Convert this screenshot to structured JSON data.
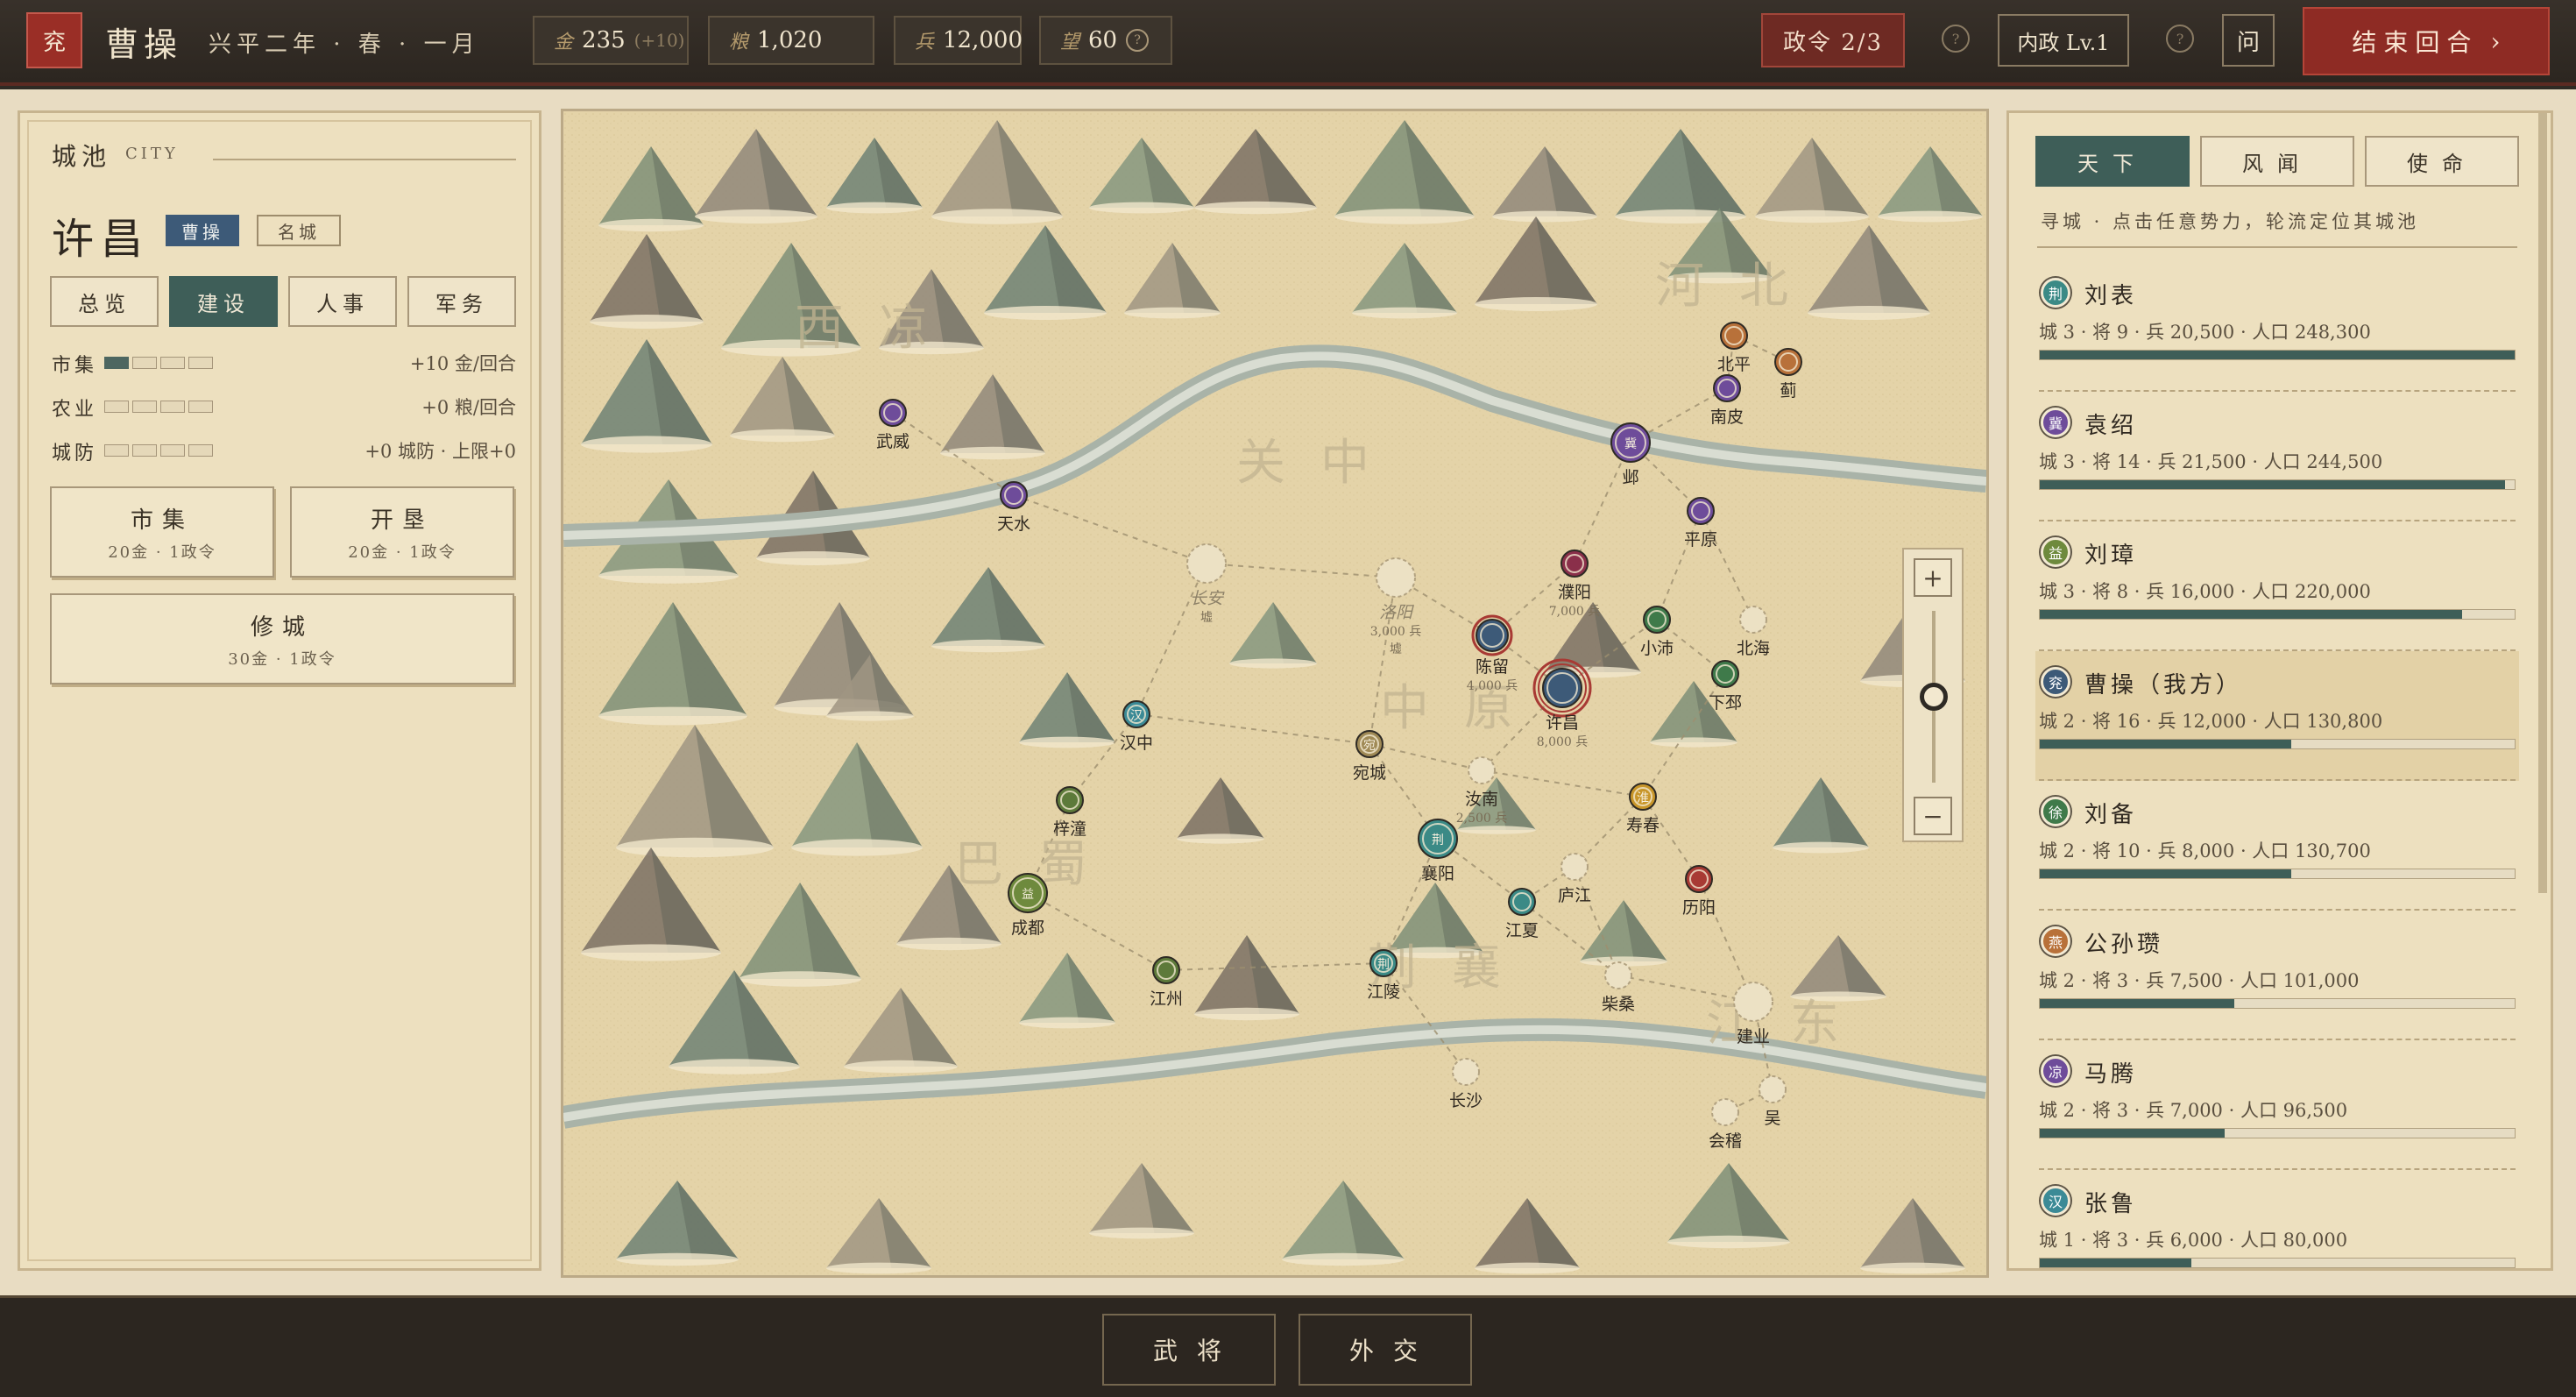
{
  "topbar": {
    "seal": "兖",
    "player": "曹操",
    "date": "兴平二年 · 春 · 一月",
    "resources": [
      {
        "label": "金",
        "value": "235",
        "sub": "(+10)"
      },
      {
        "label": "粮",
        "value": "1,020",
        "sub": ""
      },
      {
        "label": "兵",
        "value": "12,000",
        "sub": ""
      },
      {
        "label": "望",
        "value": "60",
        "sub": ""
      }
    ],
    "actions": "政令 2/3",
    "admin": "内政 Lv.1",
    "ask": "问",
    "end_turn": "结束回合",
    "end_turn_arrow": "›",
    "help_glyph": "?"
  },
  "left": {
    "title": "城池",
    "title_en": "CITY",
    "city_name": "许昌",
    "owner_tag": "曹操",
    "city_tag": "名城",
    "tabs": [
      "总览",
      "建设",
      "人事",
      "军务"
    ],
    "active_tab": 1,
    "stats": [
      {
        "name": "市集",
        "level": 1,
        "max": 4,
        "value": "+10 金/回合"
      },
      {
        "name": "农业",
        "level": 0,
        "max": 4,
        "value": "+0 粮/回合"
      },
      {
        "name": "城防",
        "level": 0,
        "max": 4,
        "value": "+0 城防 · 上限+0"
      }
    ],
    "buttons": [
      {
        "title": "市集",
        "cost": "20金 · 1政令"
      },
      {
        "title": "开垦",
        "cost": "20金 · 1政令"
      },
      {
        "title": "修城",
        "cost": "30金 · 1政令"
      }
    ]
  },
  "map": {
    "regions": [
      {
        "name": "西凉"
      },
      {
        "name": "河北"
      },
      {
        "name": "关中"
      },
      {
        "name": "中原"
      },
      {
        "name": "巴蜀"
      },
      {
        "name": "荆襄"
      },
      {
        "name": "江东"
      }
    ],
    "cities": [
      {
        "id": "wuwei",
        "name": "武威",
        "color": "#6e4c9a",
        "glyph": ""
      },
      {
        "id": "tianshui",
        "name": "天水",
        "color": "#6e4c9a",
        "glyph": ""
      },
      {
        "id": "changan",
        "name": "长安",
        "color": "",
        "glyph": "",
        "note": "墟"
      },
      {
        "id": "luoyang",
        "name": "洛阳",
        "color": "",
        "glyph": "",
        "note": "3,000 兵",
        "note2": "墟"
      },
      {
        "id": "hanzhong",
        "name": "汉中",
        "color": "#3b8a96",
        "glyph": "汉"
      },
      {
        "id": "zitong",
        "name": "梓潼",
        "color": "#5d7a3a",
        "glyph": ""
      },
      {
        "id": "chengdu",
        "name": "成都",
        "color": "#6e8a3d",
        "glyph": "益"
      },
      {
        "id": "jiangzhou",
        "name": "江州",
        "color": "#5d7a3a",
        "glyph": ""
      },
      {
        "id": "wancheng",
        "name": "宛城",
        "color": "#a08a56",
        "glyph": "宛"
      },
      {
        "id": "xiangyang",
        "name": "襄阳",
        "color": "#3b8a86",
        "glyph": "荆"
      },
      {
        "id": "jiangling",
        "name": "江陵",
        "color": "#3b8a86",
        "glyph": "荆"
      },
      {
        "id": "jiangxia",
        "name": "江夏",
        "color": "#3b8a86",
        "glyph": ""
      },
      {
        "id": "runan",
        "name": "汝南",
        "color": "",
        "glyph": "",
        "note": "2,500 兵"
      },
      {
        "id": "chenliu",
        "name": "陈留",
        "color": "#3d5a78",
        "glyph": "",
        "note": "4,000 兵"
      },
      {
        "id": "xuchang",
        "name": "许昌",
        "color": "#3d5a78",
        "glyph": "",
        "note": "8,000 兵"
      },
      {
        "id": "puyang",
        "name": "濮阳",
        "color": "#8a2f4a",
        "glyph": "",
        "note": "7,000 兵"
      },
      {
        "id": "xiaopei",
        "name": "小沛",
        "color": "#3f7a4a",
        "glyph": ""
      },
      {
        "id": "xiapi",
        "name": "下邳",
        "color": "#3f7a4a",
        "glyph": ""
      },
      {
        "id": "beihai",
        "name": "北海",
        "color": "",
        "glyph": ""
      },
      {
        "id": "pingyuan",
        "name": "平原",
        "color": "#6e4c9a",
        "glyph": ""
      },
      {
        "id": "ye",
        "name": "邺",
        "color": "#6e4c9a",
        "glyph": "冀"
      },
      {
        "id": "nanpi",
        "name": "南皮",
        "color": "#6e4c9a",
        "glyph": ""
      },
      {
        "id": "beiping",
        "name": "北平",
        "color": "#b8713a",
        "glyph": ""
      },
      {
        "id": "ji",
        "name": "蓟",
        "color": "#b8713a",
        "glyph": ""
      },
      {
        "id": "shouchun",
        "name": "寿春",
        "color": "#c8962a",
        "glyph": "淮"
      },
      {
        "id": "lujiang",
        "name": "庐江",
        "color": "",
        "glyph": ""
      },
      {
        "id": "liyang",
        "name": "历阳",
        "color": "#a83a34",
        "glyph": ""
      },
      {
        "id": "chaisang",
        "name": "柴桑",
        "color": "",
        "glyph": ""
      },
      {
        "id": "jianye",
        "name": "建业",
        "color": "",
        "glyph": ""
      },
      {
        "id": "wu",
        "name": "吴",
        "color": "",
        "glyph": ""
      },
      {
        "id": "kuaiji",
        "name": "会稽",
        "color": "",
        "glyph": ""
      },
      {
        "id": "changsha",
        "name": "长沙",
        "color": "",
        "glyph": ""
      }
    ],
    "zoom_in": "+",
    "zoom_out": "−",
    "zoom_level": 0.5
  },
  "right": {
    "tabs": [
      "天下",
      "风闻",
      "使命"
    ],
    "active_tab": 0,
    "hint": "寻城 · 点击任意势力，轮流定位其城池",
    "factions": [
      {
        "name": "刘表",
        "glyph": "荆",
        "color": "#3b8a86",
        "stats": "城 3 · 将 9 · 兵 20,500 · 人口 248,300",
        "share": 1.0
      },
      {
        "name": "袁绍",
        "glyph": "冀",
        "color": "#6e4c9a",
        "stats": "城 3 · 将 14 · 兵 21,500 · 人口 244,500",
        "share": 0.98
      },
      {
        "name": "刘璋",
        "glyph": "益",
        "color": "#6e8a3d",
        "stats": "城 3 · 将 8 · 兵 16,000 · 人口 220,000",
        "share": 0.89
      },
      {
        "name": "曹操（我方）",
        "glyph": "兖",
        "color": "#3d5a78",
        "stats": "城 2 · 将 16 · 兵 12,000 · 人口 130,800",
        "share": 0.53,
        "mine": true
      },
      {
        "name": "刘备",
        "glyph": "徐",
        "color": "#3f7a4a",
        "stats": "城 2 · 将 10 · 兵 8,000 · 人口 130,700",
        "share": 0.53
      },
      {
        "name": "公孙瓒",
        "glyph": "燕",
        "color": "#b8713a",
        "stats": "城 2 · 将 3 · 兵 7,500 · 人口 101,000",
        "share": 0.41
      },
      {
        "name": "马腾",
        "glyph": "凉",
        "color": "#6e4c9a",
        "stats": "城 2 · 将 3 · 兵 7,000 · 人口 96,500",
        "share": 0.39
      },
      {
        "name": "张鲁",
        "glyph": "汉",
        "color": "#3b8a96",
        "stats": "城 1 · 将 3 · 兵 6,000 · 人口 80,000",
        "share": 0.32
      }
    ]
  },
  "bottom": {
    "buttons": [
      "武将",
      "外交"
    ]
  }
}
